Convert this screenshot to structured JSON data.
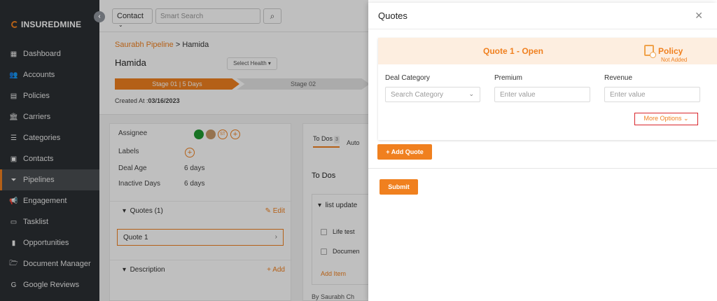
{
  "sidebar": {
    "brand": "INSUREDMINE",
    "items": [
      {
        "label": "Dashboard",
        "icon": "dashboard-icon",
        "glyph": "▦"
      },
      {
        "label": "Accounts",
        "icon": "accounts-icon",
        "glyph": "👥"
      },
      {
        "label": "Policies",
        "icon": "policies-icon",
        "glyph": "▤"
      },
      {
        "label": "Carriers",
        "icon": "carriers-icon",
        "glyph": "🏛"
      },
      {
        "label": "Categories",
        "icon": "categories-icon",
        "glyph": "☰"
      },
      {
        "label": "Contacts",
        "icon": "contacts-icon",
        "glyph": "▣"
      },
      {
        "label": "Pipelines",
        "icon": "pipelines-icon",
        "glyph": "⏷",
        "active": true
      },
      {
        "label": "Engagement",
        "icon": "megaphone-icon",
        "glyph": "📢"
      },
      {
        "label": "Tasklist",
        "icon": "tasklist-icon",
        "glyph": "▭"
      },
      {
        "label": "Opportunities",
        "icon": "chart-icon",
        "glyph": "▮"
      },
      {
        "label": "Document Manager",
        "icon": "folder-icon",
        "glyph": "🗁"
      },
      {
        "label": "Google Reviews",
        "icon": "google-icon",
        "glyph": "G"
      }
    ]
  },
  "topbar": {
    "contact_select": "Contact",
    "search_placeholder": "Smart Search"
  },
  "deal": {
    "breadcrumb_link": "Saurabh Pipeline",
    "breadcrumb_sep": " > ",
    "breadcrumb_current": "Hamida",
    "name": "Hamida",
    "health_label": "Select Health",
    "stage1": "Stage 01 | 5 Days",
    "stage2": "Stage 02",
    "created_label": "Created At :",
    "created_value": "03/16/2023",
    "assignee_label": "Assignee",
    "assignee_initials": "ST",
    "labels_label": "Labels",
    "deal_age_label": "Deal Age",
    "deal_age_value": "6 days",
    "inactive_label": "Inactive Days",
    "inactive_value": "6 days",
    "quotes_section": "Quotes (1)",
    "edit_label": "Edit",
    "quote_item": "Quote 1",
    "description_section": "Description",
    "add_label": "Add"
  },
  "todos": {
    "tab_todos": "To Dos",
    "tab_count": "3",
    "tab_auto": "Auto",
    "title": "To Dos",
    "list_title": "list update",
    "items": [
      "Life test",
      "Documen"
    ],
    "add_item": "Add Item",
    "by": "By Saurabh Ch"
  },
  "drawer": {
    "title": "Quotes",
    "quote_name": "Quote 1 - Open",
    "policy_label": "Policy",
    "policy_status": "Not Added",
    "deal_category_label": "Deal Category",
    "deal_category_placeholder": "Search Category",
    "premium_label": "Premium",
    "premium_placeholder": "Enter value",
    "revenue_label": "Revenue",
    "revenue_placeholder": "Enter value",
    "more_options": "More Options",
    "add_quote": "+ Add Quote",
    "submit": "Submit"
  },
  "colors": {
    "accent": "#f0801f",
    "sidebar_bg": "#2b2f33",
    "highlight_border": "#d9262c"
  }
}
